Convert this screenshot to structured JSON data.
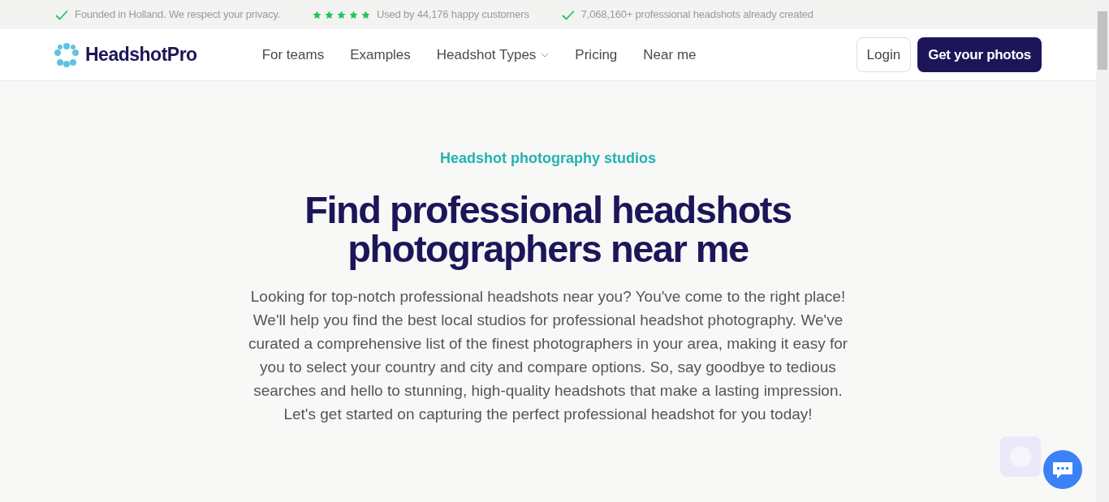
{
  "top_bar": {
    "items": [
      {
        "kind": "check",
        "text": "Founded in Holland. We respect your privacy."
      },
      {
        "kind": "stars",
        "stars": 5,
        "text": "Used by 44,176 happy customers"
      },
      {
        "kind": "check",
        "text": "7,068,160+ professional headshots already created"
      }
    ]
  },
  "navbar": {
    "logo": "HeadshotPro",
    "links": [
      {
        "label": "For teams",
        "dropdown": false
      },
      {
        "label": "Examples",
        "dropdown": false
      },
      {
        "label": "Headshot Types",
        "dropdown": true
      },
      {
        "label": "Pricing",
        "dropdown": false
      },
      {
        "label": "Near me",
        "dropdown": false
      }
    ],
    "login": "Login",
    "cta": "Get your photos"
  },
  "hero": {
    "eyebrow": "Headshot photography studios",
    "title": "Find professional headshots photographers near me",
    "body": "Looking for top-notch professional headshots near you? You've come to the right place! We'll help you find the best local studios for professional headshot photography. We've curated a comprehensive list of the finest photographers in your area, making it easy for you to select your country and city and compare options. So, say goodbye to tedious searches and hello to stunning, high-quality headshots that make a lasting impression. Let's get started on capturing the perfect professional headshot for you today!"
  }
}
